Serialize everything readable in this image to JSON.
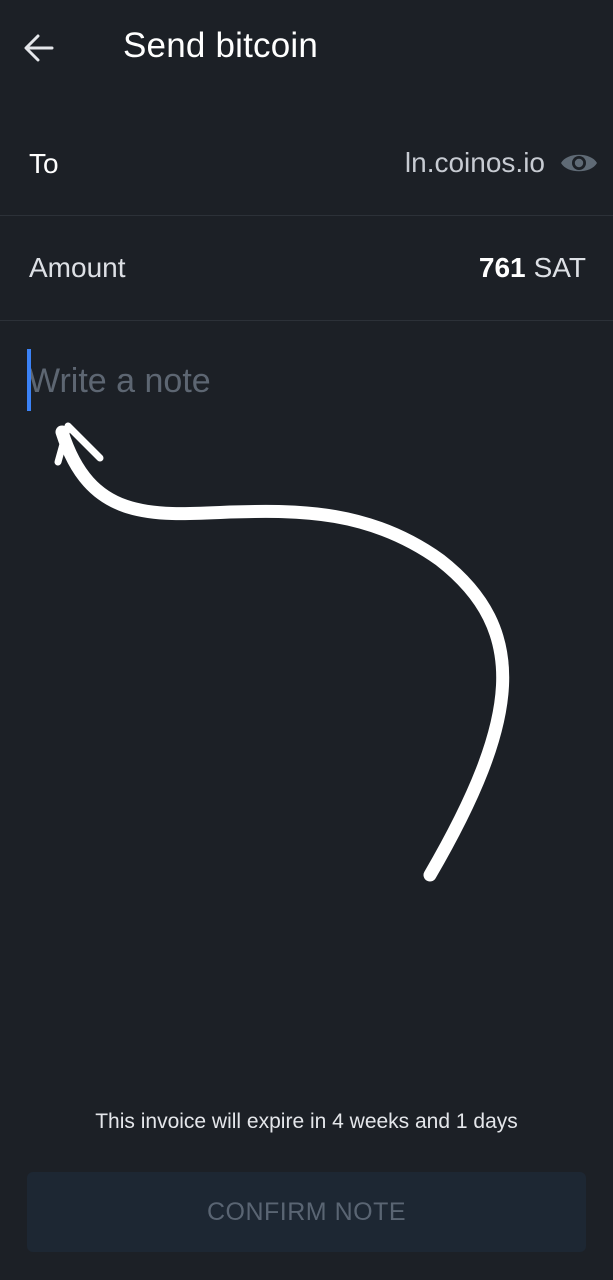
{
  "header": {
    "back_icon": "arrow-left-icon",
    "title": "Send bitcoin"
  },
  "form": {
    "to_label": "To",
    "to_value": "ln.coinos.io",
    "to_icon": "eye-icon",
    "amount_label": "Amount",
    "amount_value": "761",
    "amount_unit": "SAT",
    "note_placeholder": "Write a note",
    "note_value": ""
  },
  "footer": {
    "expiry_text": "This invoice will expire in 4 weeks and 1 days",
    "confirm_label": "CONFIRM NOTE"
  },
  "annotation": {
    "arrow_color": "#ffffff"
  },
  "colors": {
    "background": "#1c2026",
    "accent": "#3b82f6",
    "button_bg": "#1d2733"
  }
}
